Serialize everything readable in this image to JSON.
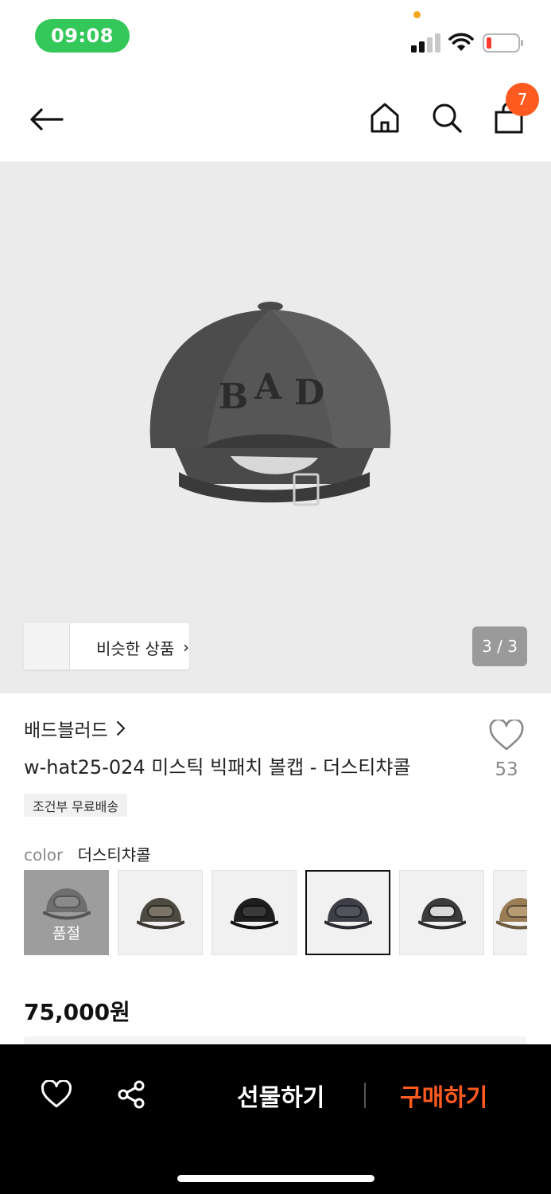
{
  "status_bar": {
    "time": "09:08",
    "battery_color": "#ff3b30",
    "time_pill_color": "#34c759"
  },
  "nav": {
    "cart_count": "7",
    "icons": [
      "back-arrow-icon",
      "home-icon",
      "search-icon",
      "shopping-bag-icon"
    ]
  },
  "gallery": {
    "similar_label": "비슷한 상품",
    "counter": "3 / 3"
  },
  "product": {
    "brand": "배드블러드",
    "title": "w-hat25-024 미스틱 빅패치 볼캡 - 더스티챠콜",
    "like_count": "53",
    "shipping_tag": "조건부 무료배송",
    "color_label": "color",
    "color_value": "더스티챠콜",
    "sold_out_label": "품절",
    "price": "75,000원"
  },
  "bottom_bar": {
    "gift_label": "선물하기",
    "buy_label": "구매하기",
    "accent": "#ff5a1f"
  }
}
